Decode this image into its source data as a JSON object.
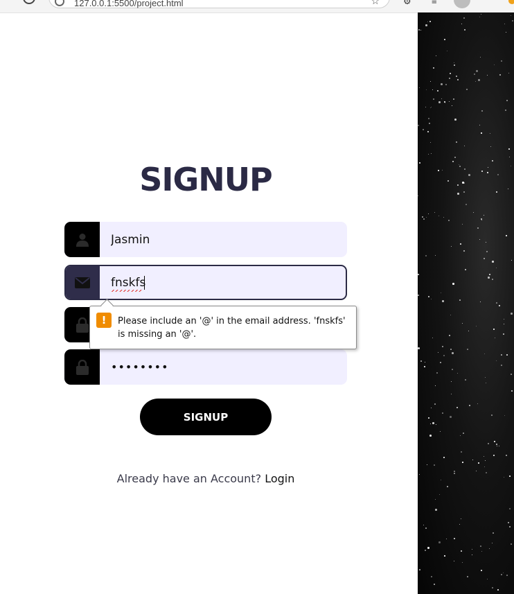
{
  "browser": {
    "url": "127.0.0.1:5500/project.html"
  },
  "form": {
    "title": "SIGNUP",
    "name_value": "Jasmin",
    "email_value": "fnskfs",
    "password1_value": "•••••••",
    "password2_value": "••••••••",
    "submit_label": "SIGNUP",
    "login_prompt": "Already have an Account?",
    "login_link": "Login"
  },
  "validation": {
    "message": "Please include an '@' in the email address. 'fnskfs' is missing an '@'."
  },
  "icons": {
    "name": "user-icon",
    "email": "envelope-icon",
    "password": "lock-icon",
    "warning": "warning-icon"
  },
  "colors": {
    "title": "#2b2a45",
    "field_bg": "#f1efff",
    "icon_box": "#000000",
    "focused_icon_box": "#2f2d4a",
    "warning": "#f08c00"
  }
}
